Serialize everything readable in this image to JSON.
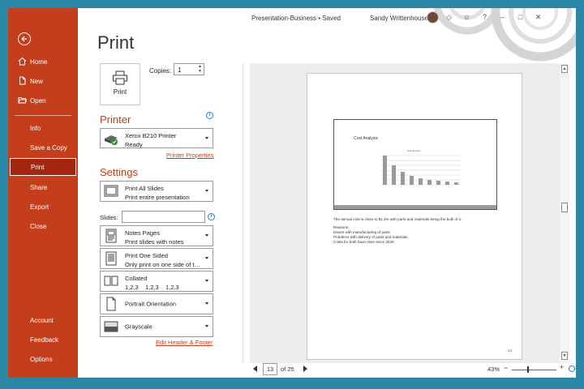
{
  "window": {
    "doc_title": "Presentation-Business • Saved",
    "user_name": "Sandy Writtenhouse"
  },
  "sidebar": {
    "back_icon": "back-arrow-icon",
    "items": [
      {
        "label": "Home",
        "icon": "home-icon"
      },
      {
        "label": "New",
        "icon": "new-file-icon"
      },
      {
        "label": "Open",
        "icon": "folder-open-icon"
      },
      {
        "label": "Info"
      },
      {
        "label": "Save a Copy"
      },
      {
        "label": "Print",
        "active": true
      },
      {
        "label": "Share"
      },
      {
        "label": "Export"
      },
      {
        "label": "Close"
      },
      {
        "label": "Account"
      },
      {
        "label": "Feedback"
      },
      {
        "label": "Options"
      }
    ],
    "colors": {
      "bg": "#c43e1c",
      "active": "#a5260e"
    }
  },
  "print": {
    "heading": "Print",
    "print_button": "Print",
    "copies_label": "Copies:",
    "copies_value": "1",
    "printer_heading": "Printer",
    "printer_name": "Xerox B210 Printer",
    "printer_status": "Ready",
    "printer_properties": "Printer Properties",
    "settings_heading": "Settings",
    "slides_range": {
      "title": "Print All Slides",
      "subtitle": "Print entire presentation"
    },
    "slides_label": "Slides:",
    "slides_value": "",
    "layout": {
      "title": "Notes Pages",
      "subtitle": "Print slides with notes"
    },
    "sides": {
      "title": "Print One Sided",
      "subtitle": "Only print on one side of th..."
    },
    "collation": {
      "title": "Collated",
      "subtitle": "1,2,3    1,2,3    1,2,3"
    },
    "orientation": "Portrait Orientation",
    "color": "Grayscale",
    "edit_header_footer": "Edit Header & Footer"
  },
  "preview": {
    "slide_title": "Cost Analysis",
    "chart_title": "Annual Cost",
    "notes": [
      "The annual cost is close to $1.4m with parts and materials  being the bulk of it.",
      "Reasons:",
      "Issues with manufacturing of parts",
      "Problems with delivery  of parts and materials",
      "Costs for both have risen since 2020"
    ],
    "page_number": "13"
  },
  "footer": {
    "current_page": "13",
    "total_pages": "of 25",
    "zoom": "43%",
    "zoom_minus": "−",
    "zoom_plus": "+"
  }
}
